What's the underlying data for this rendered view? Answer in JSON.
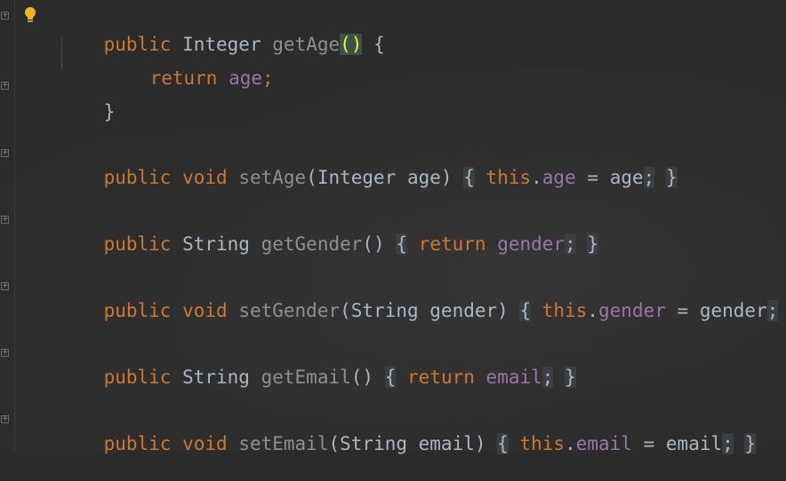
{
  "code_lines": [
    {
      "text": "public Integer getAge() {"
    },
    {
      "text": "return age;"
    },
    {
      "text": "}"
    },
    {
      "text": "public void setAge(Integer age) { this.age = age; }"
    },
    {
      "text": "public String getGender() { return gender; }"
    },
    {
      "text": "public void setGender(String gender) { this.gender = gender; }"
    },
    {
      "text": "public String getEmail() { return email; }"
    },
    {
      "text": "public void setEmail(String email) { this.email = email; }"
    }
  ],
  "tokens": {
    "public": "public",
    "integer_type": "Integer",
    "void": "void",
    "string_type": "String",
    "return": "return",
    "this": "this",
    "getAge": "getAge",
    "setAge": "setAge",
    "getGender": "getGender",
    "setGender": "setGender",
    "getEmail": "getEmail",
    "setEmail": "setEmail",
    "age": "age",
    "gender": "gender",
    "email": "email",
    "paren_pair": "()",
    "open_brace": "{",
    "close_brace": "}",
    "semicolon": ";",
    "dot": ".",
    "equals": "=",
    "open_paren": "(",
    "close_paren": ")",
    "param_integer_age": "Integer age",
    "param_string_gender": "String gender",
    "param_string_email": "String email"
  },
  "gutter": {
    "fold_icon": "fold-plus-icon",
    "fold_marker": "+",
    "intention_icon": "lightbulb-icon"
  },
  "colors": {
    "background": "#2b2b2b",
    "keyword": "#cc7832",
    "field": "#9876aa",
    "default_text": "#a9b7c6",
    "paren_highlight": "#ffef28",
    "bulb": "#f0b323"
  }
}
